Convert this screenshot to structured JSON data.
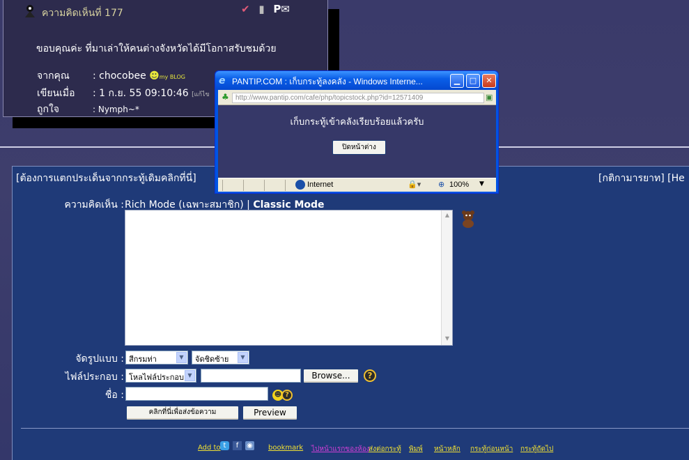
{
  "comment": {
    "header": "ความคิดเห็นที่ 177",
    "body": "ขอบคุณค่ะ ที่มาเล่าให้คนต่างจังหวัดได้มีโอกาสรับชมด้วย",
    "from_label": "จากคุณ",
    "from_value": ": chocobee",
    "myblog_tag": "my BLOG",
    "posted_label": "เขียนเมื่อ",
    "posted_value": ": 1 ก.ย. 55 09:10:46",
    "edit_tag": "[แก้ไข",
    "likes_label": "ถูกใจ",
    "likes_value": ": Nymph~*"
  },
  "reply": {
    "branch_link": "[ต้องการแตกประเด็นจากกระทู้เดิมคลิกที่นี่]",
    "rules_link": "[กติกามารยาท] [He",
    "comment_label": "ความคิดเห็น :",
    "rich_mode": "Rich Mode (เฉพาะสมาชิก)",
    "separator": "|",
    "classic_mode": "Classic Mode",
    "format_label": "จัดรูปแบบ :",
    "format_color": "สีกรมท่า",
    "format_align": "จัดชิดซ้าย",
    "attach_label": "ไฟล์ประกอบ :",
    "attach_type": "โหลไฟล์ประกอบ",
    "browse_button": "Browse...",
    "name_label": "ชื่อ :",
    "submit_button": "คลิกที่นี่เพื่อส่งข้อความ",
    "preview_button": "Preview"
  },
  "footer": {
    "add_to": "Add to",
    "links": [
      "bookmark",
      "ไปหน้าแรกของห้อง",
      "ส่งต่อกระทู้",
      "พิมพ์",
      "หน้าหลัก",
      "กระทู้ก่อนหน้า",
      "กระทู้ถัดไป"
    ]
  },
  "popup": {
    "title": "PANTIP.COM : เก็บกระทู้ลงคลัง - Windows Interne...",
    "url": "http://www.pantip.com/cafe/php/topicstock.php?id=12571409",
    "message": "เก็บกระทู้เข้าคลังเรียบร้อยแล้วครับ",
    "close_button": "ปิดหน้าต่าง",
    "zone": "Internet",
    "zoom": "100%"
  },
  "colors": {
    "page_bg": "#3e3e6c",
    "comment_bg": "#2d2b4d",
    "reply_panel_bg": "#1f3a78",
    "link_yellow": "#f0e033",
    "popup_content_bg": "#363868"
  }
}
